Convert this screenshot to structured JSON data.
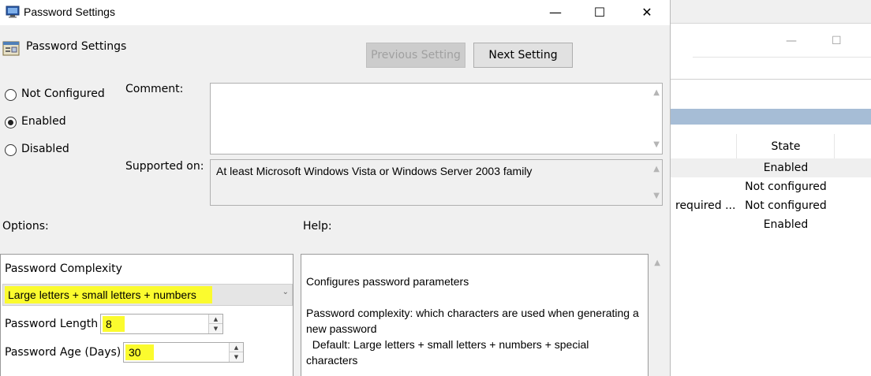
{
  "background_window": {
    "controls": {
      "minimize": "—",
      "maximize": "☐"
    },
    "state_header": "State",
    "rows": [
      {
        "name": "",
        "state": "Enabled",
        "selected": true
      },
      {
        "name": "",
        "state": "Not configured",
        "selected": false
      },
      {
        "name": "required ...",
        "state": "Not configured",
        "selected": false
      },
      {
        "name": "",
        "state": "Enabled",
        "selected": false
      }
    ]
  },
  "dialog": {
    "window_title": "Password Settings",
    "window_controls": {
      "minimize": "—",
      "maximize": "☐",
      "close": "✕"
    },
    "header_title": "Password Settings",
    "previous_setting": "Previous Setting",
    "next_setting": "Next Setting",
    "radio": {
      "not_configured": "Not Configured",
      "enabled": "Enabled",
      "disabled": "Disabled",
      "selected": "enabled"
    },
    "comment_label": "Comment:",
    "comment_value": "",
    "supported_on_label": "Supported on:",
    "supported_on_value": "At least Microsoft Windows Vista or Windows Server 2003 family",
    "options_label": "Options:",
    "help_label": "Help:",
    "options": {
      "complexity_label": "Password Complexity",
      "complexity_value": "Large letters + small letters + numbers",
      "length_label": "Password Length",
      "length_value": "8",
      "age_label": "Password Age (Days)",
      "age_value": "30"
    },
    "help": {
      "line1": "Configures password parameters",
      "line2": "Password complexity: which characters are used when generating a new password",
      "line3": "  Default: Large letters + small letters + numbers + special characters"
    }
  },
  "colors": {
    "highlight": "#fbfb2e",
    "list_header_band": "#a6bdd6",
    "dialog_bg": "#f0f0f0"
  },
  "icons": [
    "app-window-icon",
    "policy-settings-icon",
    "chevron-down-icon",
    "spin-up-icon",
    "spin-down-icon",
    "scroll-up-icon",
    "scroll-down-icon"
  ]
}
